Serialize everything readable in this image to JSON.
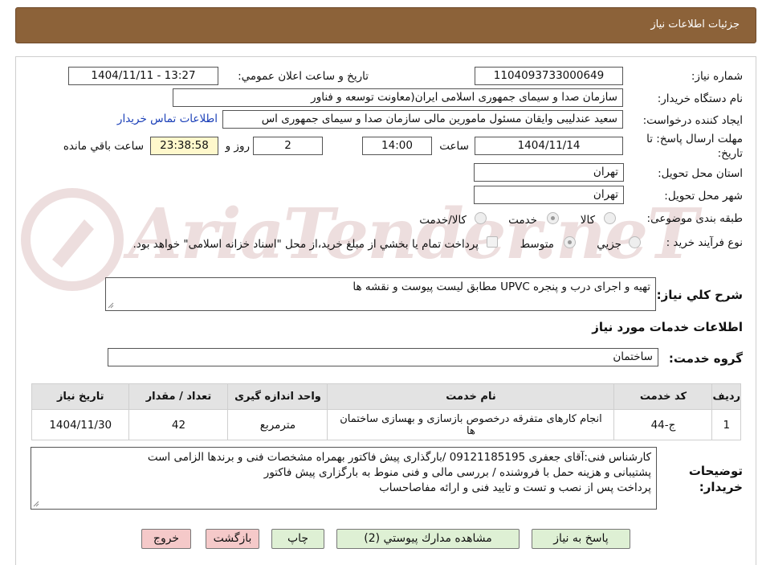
{
  "header": {
    "title": "جزئیات اطلاعات نیاز"
  },
  "form": {
    "need_number_label": "شماره نیاز:",
    "need_number": "1104093733000649",
    "announce_label": "تاریخ و ساعت اعلان عمومي:",
    "announce_value": "1404/11/11 - 13:27",
    "buyer_org_label": "نام دستگاه خريدار:",
    "buyer_org": "سازمان صدا و سیمای جمهوری اسلامی ایران(معاونت توسعه و فناور",
    "requester_label": "ايجاد كننده درخواست:",
    "requester": "سعید عندلیبی وایقان مسئول مامورین مالی  سازمان صدا و سیمای جمهوری اس",
    "contact_link": "اطلاعات تماس خريدار",
    "deadline_label_1": "مهلت ارسال پاسخ: تا",
    "deadline_label_2": "تاريخ:",
    "deadline_date": "1404/11/14",
    "time_label": "ساعت",
    "deadline_time": "14:00",
    "days": "2",
    "days_label": "روز و",
    "remaining": "23:38:58",
    "remaining_label": "ساعت باقي مانده",
    "province_label": "استان محل تحويل:",
    "province": "تهران",
    "city_label": "شهر محل تحويل:",
    "city": "تهران",
    "category_label": "طبقه بندی موضوعی:",
    "category_options": [
      "كالا",
      "خدمت",
      "كالا/خدمت"
    ],
    "category_selected": "خدمت",
    "process_label": "نوع فرآیند خرید :",
    "process_options": [
      "جزيي",
      "متوسط"
    ],
    "process_selected": "متوسط",
    "payment_note": "پرداخت تمام يا بخشي از مبلغ خريد،از محل \"اسناد خزانه اسلامی\" خواهد بود.",
    "summary_label": "شرح كلي نياز:",
    "summary": "تهیه و اجرای درب و پنجره UPVC مطابق لیست پیوست و نقشه ها",
    "services_heading": "اطلاعات خدمات مورد نياز",
    "service_group_label": "گروه خدمت:",
    "service_group": "ساختمان"
  },
  "table": {
    "headers": [
      "رديف",
      "كد خدمت",
      "نام خدمت",
      "واحد اندازه گيری",
      "تعداد / مقدار",
      "تاريخ نياز"
    ],
    "rows": [
      {
        "row": "1",
        "code": "ج-44",
        "name": "انجام کارهای متفرقه درخصوص بازسازی و بهسازی ساختمان ها",
        "unit": "مترمربع",
        "qty": "42",
        "date": "1404/11/30"
      }
    ]
  },
  "notes": {
    "label_1": "توضيحات",
    "label_2": "خريدار:",
    "line_1": "کارشناس فنی:آقای جعفری 09121185195 /بارگذاری پیش فاکتور بهمراه مشخصات فنی و برندها الزامی است",
    "line_2": "پشتیبانی و هزینه حمل با فروشنده / بررسی مالی و فنی منوط به بارگزاری پیش فاکتور",
    "line_3": "پرداخت پس از نصب و تست و تایید فنی و ارائه مفاصاحساب"
  },
  "buttons": {
    "reply": "پاسخ به نياز",
    "attachments": "مشاهده مدارك پيوستي (2)",
    "print": "چاپ",
    "back": "بازگشت",
    "exit": "خروج"
  },
  "watermark": {
    "text": "AriaTender.neT"
  },
  "colors": {
    "header_bg": "#8c6239",
    "link": "#1a3fb8",
    "remaining_bg": "#fff8cc",
    "green_btn": "#def0d4",
    "pink_btn": "#f5c9c9"
  }
}
